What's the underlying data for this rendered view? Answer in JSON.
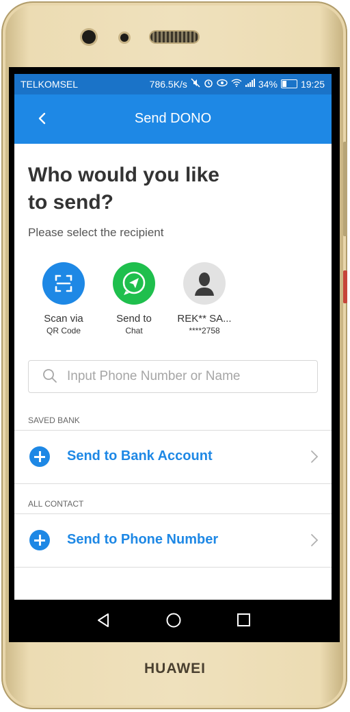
{
  "device": {
    "brand": "HUAWEI"
  },
  "status_bar": {
    "carrier": "TELKOMSEL",
    "speed": "786.5K/s",
    "battery": "34%",
    "time": "19:25"
  },
  "app_bar": {
    "title": "Send DONO"
  },
  "header": {
    "title_line1": "Who would you like",
    "title_line2": "to send?",
    "subtitle": "Please select the recipient"
  },
  "quick_actions": [
    {
      "label": "Scan via",
      "sublabel": "QR Code",
      "icon": "qr-scan-icon",
      "color": "#1e88e5"
    },
    {
      "label": "Send to",
      "sublabel": "Chat",
      "icon": "chat-send-icon",
      "color": "#1fbf4d"
    },
    {
      "label": "REK** SA...",
      "sublabel": "****2758",
      "icon": "person-icon",
      "color": "#e2e2e2"
    }
  ],
  "search": {
    "placeholder": "Input Phone Number or Name",
    "value": ""
  },
  "sections": {
    "saved_bank": {
      "label": "SAVED BANK",
      "action": "Send to Bank Account"
    },
    "all_contact": {
      "label": "ALL CONTACT",
      "action": "Send to Phone Number"
    }
  },
  "colors": {
    "accent": "#1e88e5",
    "status_bar": "#1a73c8",
    "chat_green": "#1fbf4d"
  }
}
